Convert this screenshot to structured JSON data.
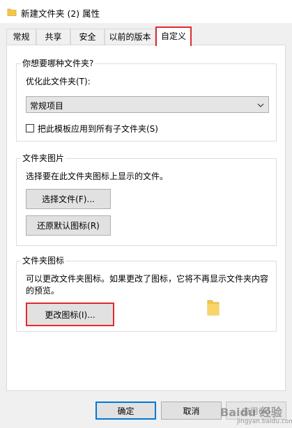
{
  "window": {
    "title": "新建文件夹 (2) 属性",
    "title_icon": "folder-icon"
  },
  "tabs": [
    {
      "label": "常规"
    },
    {
      "label": "共享"
    },
    {
      "label": "安全"
    },
    {
      "label": "以前的版本"
    },
    {
      "label": "自定义",
      "active": true
    }
  ],
  "optimize": {
    "group_label": "你想要哪种文件夹?",
    "field_label": "优化此文件夹(T):",
    "selected": "常规项目",
    "checkbox_label": "把此模板应用到所有子文件夹(S)",
    "checked": false
  },
  "folder_pictures": {
    "group_label": "文件夹图片",
    "description": "选择要在此文件夹图标上显示的文件。",
    "choose_button": "选择文件(F)...",
    "restore_button": "还原默认图标(R)"
  },
  "folder_icons": {
    "group_label": "文件夹图标",
    "description_line1": "可以更改文件夹图标。如果更改了图标，它将不再显示文件夹内容",
    "description_line2": "的预览。",
    "change_button": "更改图标(I)..."
  },
  "footer": {
    "ok": "确定",
    "cancel": "取消",
    "apply": "应用(A)"
  },
  "watermark": {
    "text": "Baidu 经验",
    "sub": "jingyan.baidu.com"
  },
  "colors": {
    "highlight": "#e02b2b",
    "focus": "#0078d7",
    "folder": "#f3c74f"
  }
}
